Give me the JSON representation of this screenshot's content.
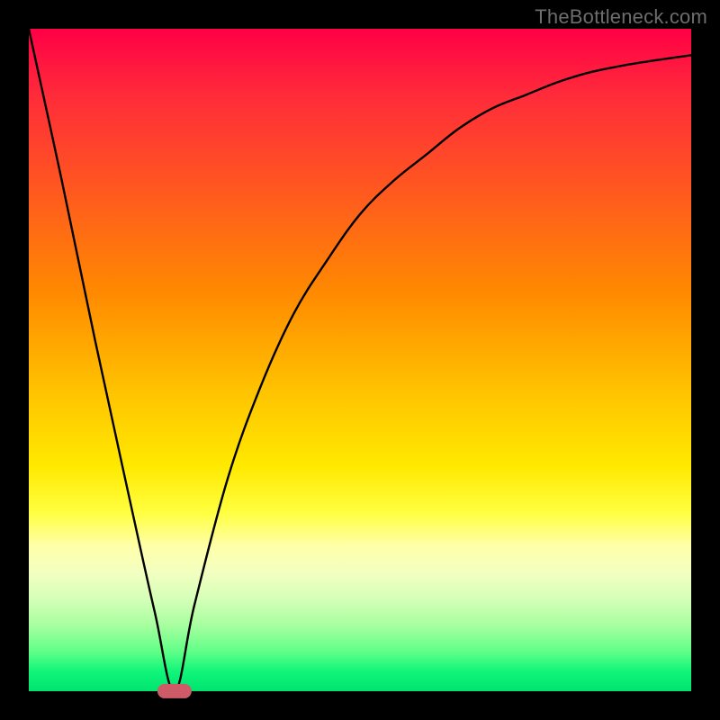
{
  "watermark": "TheBottleneck.com",
  "chart_data": {
    "type": "line",
    "title": "",
    "xlabel": "",
    "ylabel": "",
    "xlim": [
      0,
      100
    ],
    "ylim": [
      0,
      100
    ],
    "grid": false,
    "legend": false,
    "series": [
      {
        "name": "curve",
        "color": "#000000",
        "stroke_width": 2.4,
        "x": [
          0,
          5,
          10,
          15,
          19,
          22,
          25,
          30,
          35,
          40,
          45,
          50,
          55,
          60,
          65,
          70,
          75,
          80,
          85,
          90,
          95,
          100
        ],
        "y": [
          100,
          77,
          53,
          30,
          12,
          0,
          13,
          32,
          46,
          57,
          65,
          72,
          77,
          81,
          85,
          88,
          90,
          92,
          93.5,
          94.5,
          95.3,
          96
        ]
      }
    ],
    "marker": {
      "shape": "rounded-rect",
      "color": "#cf5b69",
      "x": 22,
      "y": 0,
      "width_pct": 5.2,
      "height_pct": 2.2
    },
    "background_gradient": {
      "orientation": "vertical",
      "stops": [
        {
          "pct": 0,
          "color": "#ff0046"
        },
        {
          "pct": 24,
          "color": "#ff5720"
        },
        {
          "pct": 55,
          "color": "#ffc400"
        },
        {
          "pct": 73,
          "color": "#ffff40"
        },
        {
          "pct": 90,
          "color": "#a8ffa0"
        },
        {
          "pct": 100,
          "color": "#00e46e"
        }
      ]
    }
  }
}
